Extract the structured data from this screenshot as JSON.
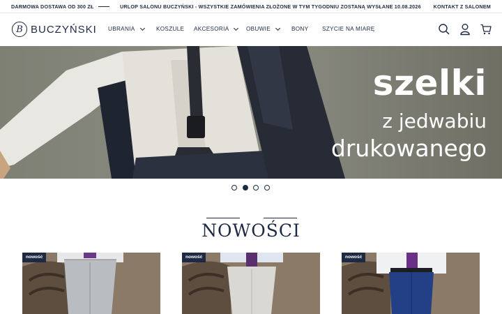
{
  "topbar": {
    "free_shipping": "DARMOWA DOSTAWA OD 300 ZŁ",
    "notice": "URLOP SALONU BUCZYŃSKI - WSZYSTKIE ZAMÓWIENIA ZŁOŻONE W TYM TYGODNIU ZOSTANĄ WYSŁANE 10.08.2026",
    "contact": "KONTAKT Z SALONEM"
  },
  "header": {
    "logo_mark": "B",
    "logo_text": "BUCZYŃSKI",
    "nav": [
      {
        "label": "UBRANIA",
        "has_dropdown": true
      },
      {
        "label": "KOSZULE",
        "has_dropdown": false
      },
      {
        "label": "AKCESORIA",
        "has_dropdown": true
      },
      {
        "label": "OBUWIE",
        "has_dropdown": true
      },
      {
        "label": "BONY",
        "has_dropdown": false
      },
      {
        "label": "SZYCIE NA MIARĘ",
        "has_dropdown": false
      }
    ],
    "icons": [
      "search-icon",
      "user-icon",
      "cart-icon"
    ]
  },
  "hero": {
    "line1": "szelki",
    "line2": "z jedwabiu",
    "line3": "drukowanego",
    "slides_total": 4,
    "active_slide": 2
  },
  "section": {
    "title": "NOWOŚCI"
  },
  "products": [
    {
      "badge": "nowość",
      "trouser_color": "#b9bcc0"
    },
    {
      "badge": "nowość",
      "trouser_color": "#d9d8d2"
    },
    {
      "badge": "nowość",
      "trouser_color": "#233f86"
    }
  ],
  "colors": {
    "brand": "#1e2a44",
    "badge_bg": "#1e2a44"
  }
}
